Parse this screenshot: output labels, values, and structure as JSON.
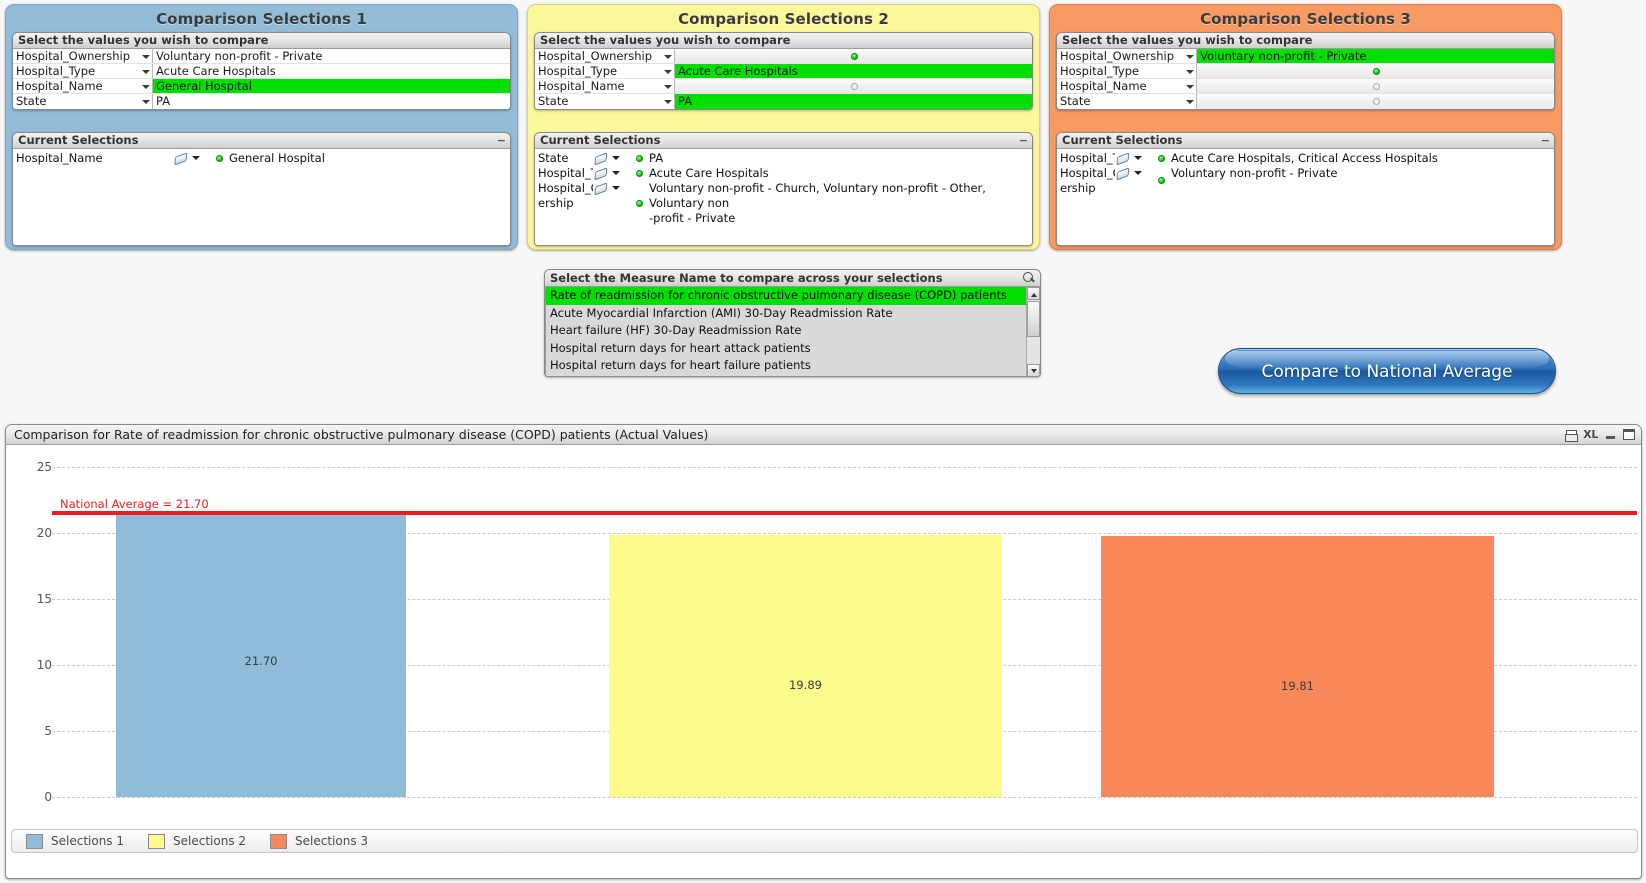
{
  "panels": [
    {
      "title": "Comparison Selections 1",
      "color": "#93bcd9",
      "multibox": {
        "caption": "Select the values you wish to compare",
        "rows": [
          {
            "field": "Hospital_Ownership",
            "value": "Voluntary non-profit - Private",
            "state": "plain"
          },
          {
            "field": "Hospital_Type",
            "value": "Acute Care Hospitals",
            "state": "plain"
          },
          {
            "field": "Hospital_Name",
            "value": "General Hospital",
            "state": "selected"
          },
          {
            "field": "State",
            "value": "PA",
            "state": "plain"
          }
        ]
      },
      "current": {
        "caption": "Current Selections",
        "rows": [
          {
            "field": "Hospital_Name",
            "value": "General Hospital",
            "dot": "green"
          }
        ]
      }
    },
    {
      "title": "Comparison Selections 2",
      "color": "#fcf79b",
      "multibox": {
        "caption": "Select the values you wish to compare",
        "rows": [
          {
            "field": "Hospital_Ownership",
            "value": "",
            "state": "gray",
            "dot": "green"
          },
          {
            "field": "Hospital_Type",
            "value": "Acute Care Hospitals",
            "state": "selected"
          },
          {
            "field": "Hospital_Name",
            "value": "",
            "state": "gray",
            "dot": "empty"
          },
          {
            "field": "State",
            "value": "PA",
            "state": "selected"
          }
        ]
      },
      "current": {
        "caption": "Current Selections",
        "rows": [
          {
            "field": "State",
            "value": "PA",
            "dot": "green"
          },
          {
            "field": "Hospital_Ty",
            "value": "Acute Care Hospitals",
            "dot": "green"
          },
          {
            "field": "Hospital_Ow",
            "field2": "ership",
            "value": "Voluntary non-profit - Church, Voluntary non-profit - Other, Voluntary non\n-profit - Private",
            "dot": "green"
          }
        ]
      }
    },
    {
      "title": "Comparison Selections 3",
      "color": "#f79a63",
      "multibox": {
        "caption": "Select the values you wish to compare",
        "rows": [
          {
            "field": "Hospital_Ownership",
            "value": "Voluntary non-profit - Private",
            "state": "selected"
          },
          {
            "field": "Hospital_Type",
            "value": "",
            "state": "gray",
            "dot": "green"
          },
          {
            "field": "Hospital_Name",
            "value": "",
            "state": "gray",
            "dot": "empty"
          },
          {
            "field": "State",
            "value": "",
            "state": "gray",
            "dot": "empty"
          }
        ]
      },
      "current": {
        "caption": "Current Selections",
        "rows": [
          {
            "field": "Hospital_Ty",
            "value": "Acute Care Hospitals, Critical Access Hospitals",
            "dot": "green"
          },
          {
            "field": "Hospital_Ow",
            "field2": "ership",
            "value": "Voluntary non-profit - Private",
            "dot": "green"
          }
        ]
      }
    }
  ],
  "measure_box": {
    "caption": "Select the Measure Name to compare across your selections",
    "search_icon": "search-icon",
    "items": [
      {
        "label": "Rate of readmission for chronic obstructive pulmonary disease (COPD) patients",
        "selected": true
      },
      {
        "label": "Acute Myocardial Infarction (AMI) 30-Day Readmission Rate",
        "selected": false
      },
      {
        "label": "Heart failure (HF) 30-Day Readmission Rate",
        "selected": false
      },
      {
        "label": "Hospital return days for heart attack patients",
        "selected": false
      },
      {
        "label": "Hospital return days for heart failure patients",
        "selected": false
      }
    ]
  },
  "compare_button": {
    "label": "Compare to National Average"
  },
  "chart": {
    "caption": "Comparison for Rate of readmission for chronic obstructive pulmonary disease (COPD) patients (Actual Values)",
    "icons": [
      "print-icon",
      "excel-export-icon",
      "minimize-icon",
      "maximize-icon"
    ],
    "excel_label": "XL"
  },
  "chart_data": {
    "type": "bar",
    "title": "Comparison for Rate of readmission for chronic obstructive pulmonary disease (COPD) patients (Actual Values)",
    "categories": [
      "Selections 1",
      "Selections 2",
      "Selections 3"
    ],
    "values": [
      21.7,
      19.89,
      19.81
    ],
    "value_labels": [
      "21.70",
      "19.89",
      "19.81"
    ],
    "colors": [
      "#90bcd9",
      "#fdfb8c",
      "#f9895a"
    ],
    "xlabel": "",
    "ylabel": "",
    "ylim": [
      0,
      25
    ],
    "yticks": [
      0,
      5,
      10,
      15,
      20,
      25
    ],
    "ytick_labels": [
      "0",
      "5",
      "10",
      "15",
      "20",
      "25"
    ],
    "grid": true,
    "legend_position": "bottom",
    "legend": [
      "Selections 1",
      "Selections 2",
      "Selections 3"
    ],
    "reference_line": {
      "label": "National Average = 21.70",
      "value": 21.7,
      "color": "#ec1c24"
    }
  }
}
